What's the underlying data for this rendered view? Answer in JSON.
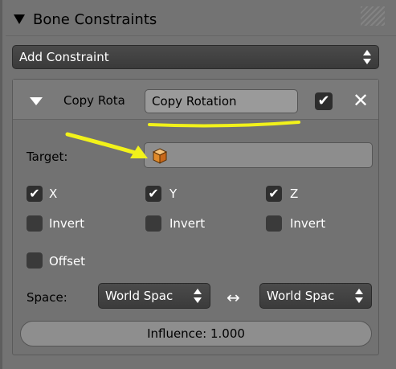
{
  "panel": {
    "title": "Bone Constraints",
    "add_constraint_label": "Add Constraint"
  },
  "constraint": {
    "type_label": "Copy Rota",
    "name_value": "Copy Rotation",
    "enabled_check": "✔",
    "close_glyph": "✕",
    "target_label": "Target:",
    "axes": [
      {
        "label": "X",
        "checked": true,
        "check_glyph": "✔"
      },
      {
        "label": "Y",
        "checked": true,
        "check_glyph": "✔"
      },
      {
        "label": "Z",
        "checked": true,
        "check_glyph": "✔"
      }
    ],
    "invert": [
      {
        "label": "Invert",
        "checked": false
      },
      {
        "label": "Invert",
        "checked": false
      },
      {
        "label": "Invert",
        "checked": false
      }
    ],
    "offset_label": "Offset",
    "space_label": "Space:",
    "owner_space": "World Spac",
    "swap_glyph": "↔",
    "target_space": "World Spac",
    "influence_text": "Influence: 1.000"
  },
  "colors": {
    "annotation": "#f2f21a",
    "panel_bg": "#737373",
    "widget_dark": "#3b3b3b"
  }
}
